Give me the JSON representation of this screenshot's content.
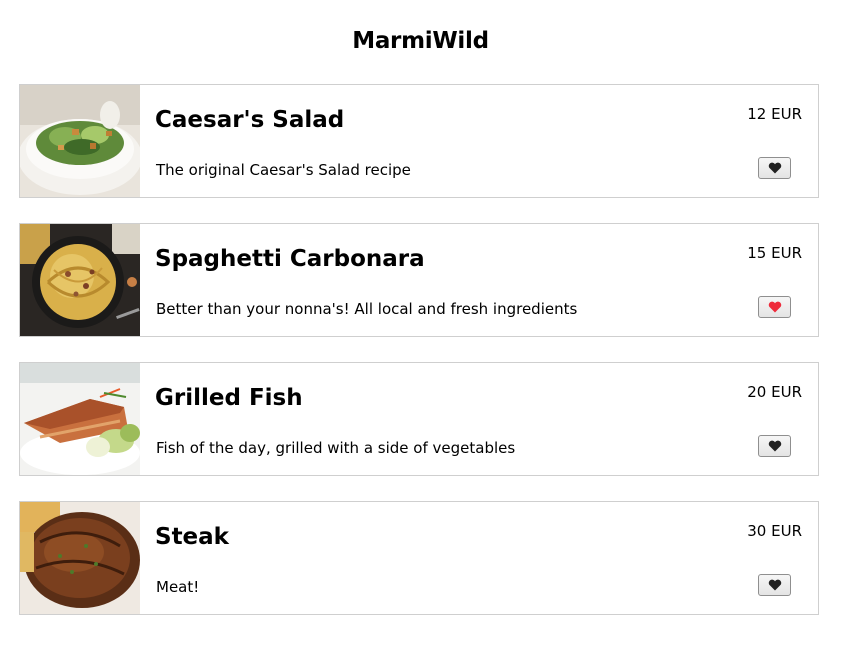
{
  "app": {
    "title": "MarmiWild"
  },
  "colors": {
    "heart_default": "#222222",
    "heart_active": "#ee2b3b",
    "card_border": "#cfcfcf"
  },
  "menu": {
    "items": [
      {
        "name": "Caesar's Salad",
        "description": "The original Caesar's Salad recipe",
        "price": "12 EUR",
        "favorite": false,
        "image_icon": "salad-photo"
      },
      {
        "name": "Spaghetti Carbonara",
        "description": "Better than your nonna's! All local and fresh ingredients",
        "price": "15 EUR",
        "favorite": true,
        "image_icon": "spaghetti-photo"
      },
      {
        "name": "Grilled Fish",
        "description": "Fish of the day, grilled with a side of vegetables",
        "price": "20 EUR",
        "favorite": false,
        "image_icon": "fish-photo"
      },
      {
        "name": "Steak",
        "description": "Meat!",
        "price": "30 EUR",
        "favorite": false,
        "image_icon": "steak-photo"
      }
    ]
  }
}
